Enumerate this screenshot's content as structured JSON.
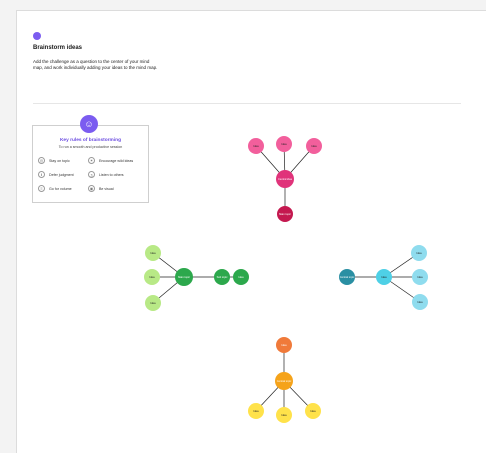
{
  "header": {
    "title": "Brainstorm ideas",
    "description": "Add the challenge as a question to the center of your mind map, and work individually adding your ideas to the mind map."
  },
  "rules_card": {
    "title": "Key rules of brainstorming",
    "subtitle": "To run a smooth and productive session",
    "rules": [
      {
        "label": "Stay on topic",
        "icon": "target-icon"
      },
      {
        "label": "Encourage wild ideas",
        "icon": "lightbulb-icon"
      },
      {
        "label": "Defer judgment",
        "icon": "pause-icon"
      },
      {
        "label": "Listen to others",
        "icon": "ear-icon"
      },
      {
        "label": "Go for volume",
        "icon": "stack-icon"
      },
      {
        "label": "Be visual",
        "icon": "eye-icon"
      }
    ]
  },
  "mind_maps": [
    {
      "name": "pink-map",
      "color": "#e0337a",
      "light": "#f25f9c",
      "nodes": [
        "Idea",
        "Idea",
        "Idea",
        "Central idea",
        "Main topic"
      ]
    },
    {
      "name": "green-map",
      "color": "#2ca84c",
      "light": "#b8e986",
      "nodes": [
        "Idea",
        "Idea",
        "Idea",
        "Main topic",
        "Sub topic",
        "Idea"
      ]
    },
    {
      "name": "blue-map",
      "color": "#2a8fa3",
      "light": "#8fdcee",
      "nodes": [
        "Central topic",
        "Idea",
        "Idea",
        "Idea",
        "Idea"
      ]
    },
    {
      "name": "yellow-map",
      "color": "#f5a31a",
      "light": "#ffe24a",
      "nodes": [
        "Idea",
        "Central topic",
        "Idea",
        "Idea",
        "Idea"
      ]
    }
  ]
}
